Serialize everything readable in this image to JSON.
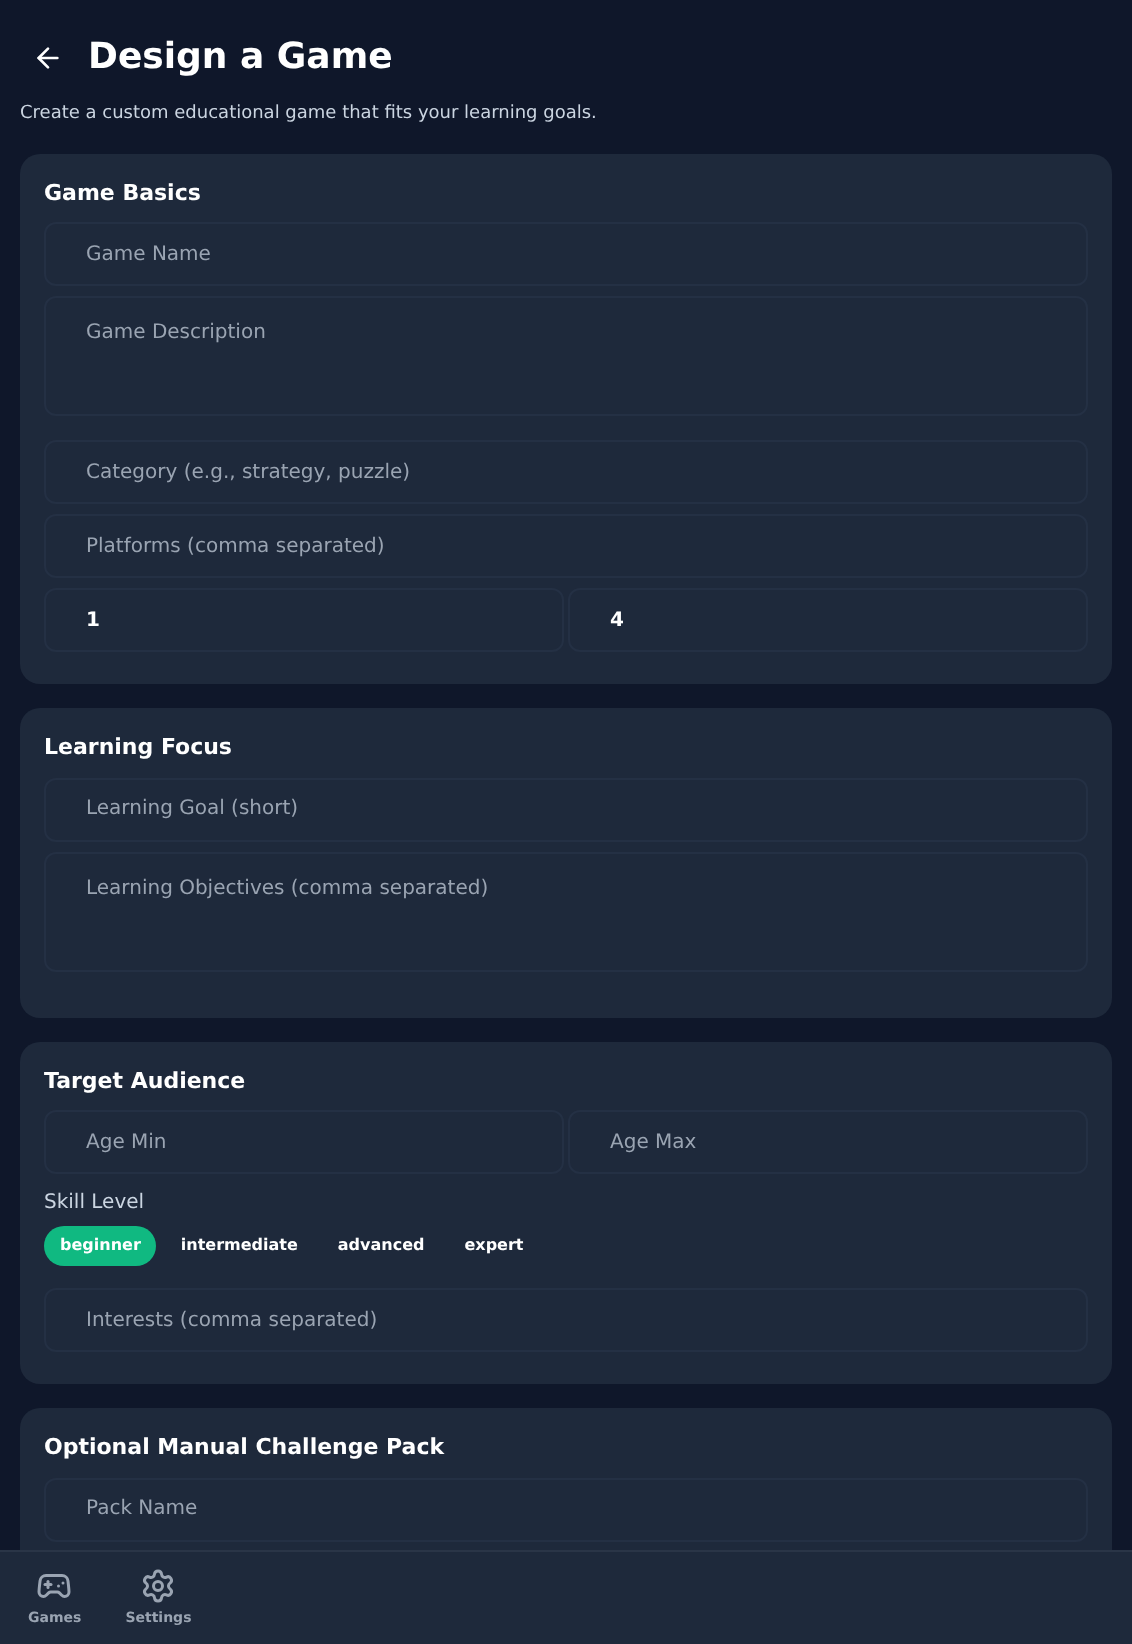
{
  "header": {
    "title": "Design a Game",
    "subtitle": "Create a custom educational game that fits your learning goals."
  },
  "sections": [
    {
      "title": "Game Basics",
      "rows": [
        {
          "kind": "input",
          "fields": [
            {
              "placeholder": "Game Name"
            }
          ]
        },
        {
          "kind": "textarea",
          "fields": [
            {
              "placeholder": "Game Description"
            }
          ]
        },
        {
          "kind": "input",
          "fields": [
            {
              "placeholder": "Category (e.g., strategy, puzzle)"
            }
          ]
        },
        {
          "kind": "input",
          "fields": [
            {
              "placeholder": "Platforms (comma separated)"
            }
          ]
        },
        {
          "kind": "input",
          "fields": [
            {
              "value": "1"
            },
            {
              "value": "4"
            }
          ]
        }
      ]
    },
    {
      "title": "Learning Focus",
      "rows": [
        {
          "kind": "input",
          "fields": [
            {
              "placeholder": "Learning Goal (short)"
            }
          ]
        },
        {
          "kind": "textarea",
          "fields": [
            {
              "placeholder": "Learning Objectives (comma separated)"
            }
          ]
        }
      ]
    },
    {
      "title": "Target Audience",
      "rows": [
        {
          "kind": "input",
          "fields": [
            {
              "placeholder": "Age Min"
            },
            {
              "placeholder": "Age Max"
            }
          ]
        },
        {
          "kind": "chips",
          "label": "Skill Level",
          "options": [
            {
              "label": "beginner",
              "selected": true
            },
            {
              "label": "intermediate",
              "selected": false
            },
            {
              "label": "advanced",
              "selected": false
            },
            {
              "label": "expert",
              "selected": false
            }
          ]
        },
        {
          "kind": "input",
          "fields": [
            {
              "placeholder": "Interests (comma separated)"
            }
          ]
        }
      ]
    },
    {
      "title": "Optional Manual Challenge Pack",
      "rows": [
        {
          "kind": "input",
          "fields": [
            {
              "placeholder": "Pack Name"
            }
          ]
        }
      ]
    }
  ],
  "nav": [
    {
      "kind": "games",
      "label": "Games"
    },
    {
      "kind": "settings",
      "label": "Settings"
    }
  ]
}
